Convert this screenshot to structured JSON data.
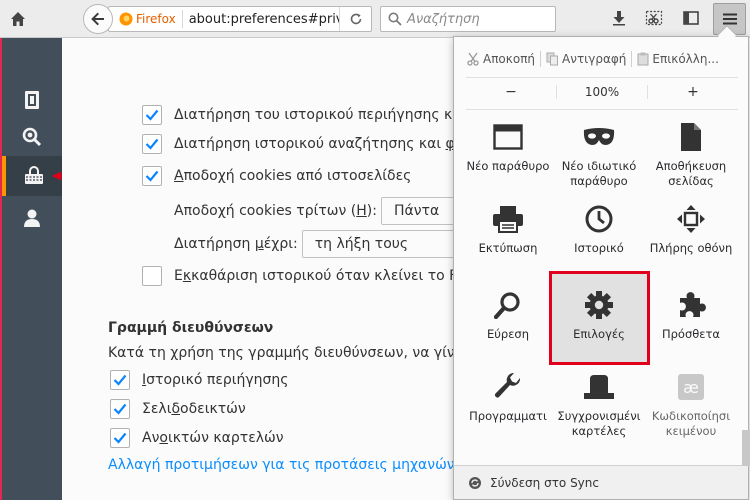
{
  "toolbar": {
    "brand_label": "Firefox",
    "url": "about:preferences#privacy",
    "search_placeholder": "Αναζήτηση"
  },
  "sidebar": {
    "categories": [
      {
        "name": "general",
        "icon": "page-icon"
      },
      {
        "name": "search",
        "icon": "magnifier-icon"
      },
      {
        "name": "privacy",
        "icon": "mask-icon",
        "selected": true
      },
      {
        "name": "sync",
        "icon": "person-icon"
      }
    ]
  },
  "content": {
    "history": {
      "keep_browsing": "Διατήρηση του ιστορικού περιήγησης κ",
      "keep_search_prefix": "Διατήρηση ιστορικού αναζήτησης και ",
      "keep_search_u": "φ",
      "accept_cookies_u": "Α",
      "accept_cookies_rest": "ποδοχή cookies από ιστοσελίδες",
      "third_party_prefix": "Αποδοχή cookies τρίτων (",
      "third_party_u": "Η",
      "third_party_suffix": "):",
      "third_party_value": "Πάντα",
      "keep_until_prefix": "Διατήρηση ",
      "keep_until_u": "μ",
      "keep_until_suffix": "έχρι:",
      "keep_until_value": "τη λήξη τους",
      "clear_on_close_prefix": "Ε",
      "clear_on_close_u": "κ",
      "clear_on_close_rest": "καθάριση ιστορικού όταν κλείνει το Fir"
    },
    "address_bar": {
      "title": "Γραμμή διευθύνσεων",
      "description": "Κατά τη χρήση της γραμμής διευθύνσεων, να γίνετ",
      "opt_history_u": "Ι",
      "opt_history_rest": "στορικό περιήγησης",
      "opt_bookmarks_prefix": "Σελι",
      "opt_bookmarks_u": "δ",
      "opt_bookmarks_rest": "οδεικτών",
      "opt_tabs_prefix": "Αν",
      "opt_tabs_u": "ο",
      "opt_tabs_rest": "ικτών καρτελών",
      "link": "Αλλαγή προτιμήσεων για τις προτάσεις μηχανών α"
    }
  },
  "panel": {
    "cut": "Αποκοπή",
    "copy": "Αντιγραφή",
    "paste": "Επικόλλη...",
    "zoom_out": "−",
    "zoom": "100%",
    "zoom_in": "+",
    "tiles": [
      {
        "label": "Νέο παράθυρο",
        "icon": "new-window-icon"
      },
      {
        "label": "Νέο ιδιωτικό παράθυρο",
        "icon": "private-mask-icon"
      },
      {
        "label": "Αποθήκευση σελίδας",
        "icon": "save-page-icon"
      },
      {
        "label": "Εκτύπωση",
        "icon": "print-icon"
      },
      {
        "label": "Ιστορικό",
        "icon": "history-clock-icon"
      },
      {
        "label": "Πλήρης οθόνη",
        "icon": "fullscreen-icon"
      },
      {
        "label": "Εύρεση",
        "icon": "find-icon"
      },
      {
        "label": "Επιλογές",
        "icon": "options-gear-icon"
      },
      {
        "label": "Πρόσθετα",
        "icon": "addons-puzzle-icon"
      },
      {
        "label": "Προγραμματι",
        "icon": "developer-wrench-icon"
      },
      {
        "label": "Συγχρονισμένι καρτέλες",
        "icon": "synced-tabs-icon"
      },
      {
        "label": "Κωδικοποίησι κειμένου",
        "icon": "text-encoding-icon"
      }
    ],
    "footer": "Σύνδεση στο Sync"
  },
  "colors": {
    "accent_orange": "#ff9500",
    "highlight_red": "#e0001b",
    "link_blue": "#0a8dff",
    "sidebar_bg": "#424f5a"
  }
}
